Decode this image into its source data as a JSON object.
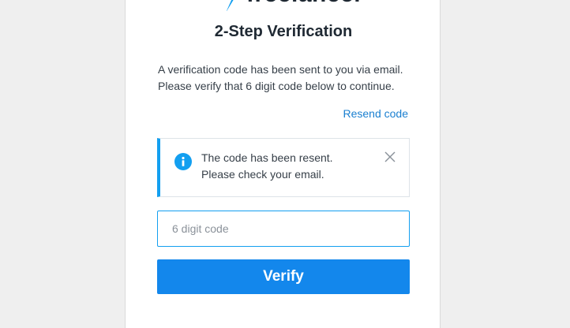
{
  "brand": {
    "logo_text": "freelancer",
    "accent_color": "#139ff0",
    "button_color": "#1387ec",
    "link_color": "#1a7fd0"
  },
  "header": {
    "title": "2-Step Verification"
  },
  "description": {
    "line1": "A verification code has been sent to you via email.",
    "line2": "Please verify that 6 digit code below to continue."
  },
  "resend": {
    "label": "Resend code"
  },
  "alert": {
    "icon": "info-icon",
    "line1": "The code has been resent.",
    "line2": "Please check your email.",
    "close_icon": "close-icon"
  },
  "code_field": {
    "value": "",
    "placeholder": "6 digit code"
  },
  "verify": {
    "label": "Verify"
  }
}
